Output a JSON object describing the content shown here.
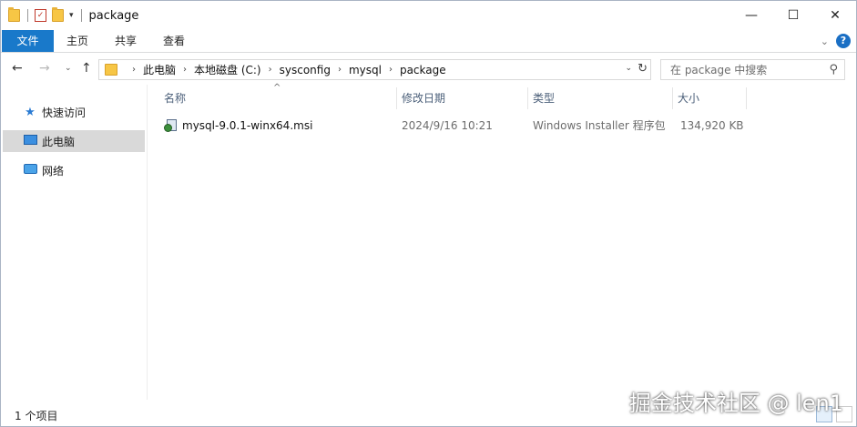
{
  "window": {
    "title": "package",
    "controls": {
      "minimize": "—",
      "maximize": "☐",
      "close": "✕"
    }
  },
  "ribbon": {
    "tabs": [
      "文件",
      "主页",
      "共享",
      "查看"
    ],
    "help_label": "?",
    "expand_label": "⌄"
  },
  "navigation": {
    "back": "←",
    "forward": "→",
    "recent": "⌄",
    "up": "↑"
  },
  "address": {
    "breadcrumbs": [
      "此电脑",
      "本地磁盘 (C:)",
      "sysconfig",
      "mysql",
      "package"
    ],
    "separator": "›"
  },
  "search": {
    "placeholder": "在 package 中搜索"
  },
  "sidebar": {
    "items": [
      {
        "label": "快速访问",
        "icon": "star-icon",
        "selected": false
      },
      {
        "label": "此电脑",
        "icon": "computer-icon",
        "selected": true
      },
      {
        "label": "网络",
        "icon": "network-icon",
        "selected": false
      }
    ]
  },
  "filelist": {
    "columns": [
      "名称",
      "修改日期",
      "类型",
      "大小"
    ],
    "sorted_column": "名称",
    "rows": [
      {
        "name": "mysql-9.0.1-winx64.msi",
        "modified": "2024/9/16 10:21",
        "type": "Windows Installer 程序包",
        "size": "134,920 KB",
        "icon": "msi-installer-icon"
      }
    ]
  },
  "status": {
    "item_count": "1 个项目"
  },
  "watermark": "掘金技术社区 @ len1",
  "colors": {
    "file_tab": "#1979ca",
    "selection": "#d9d9d9",
    "column_header_text": "#4c607a",
    "folder": "#f7c645"
  }
}
